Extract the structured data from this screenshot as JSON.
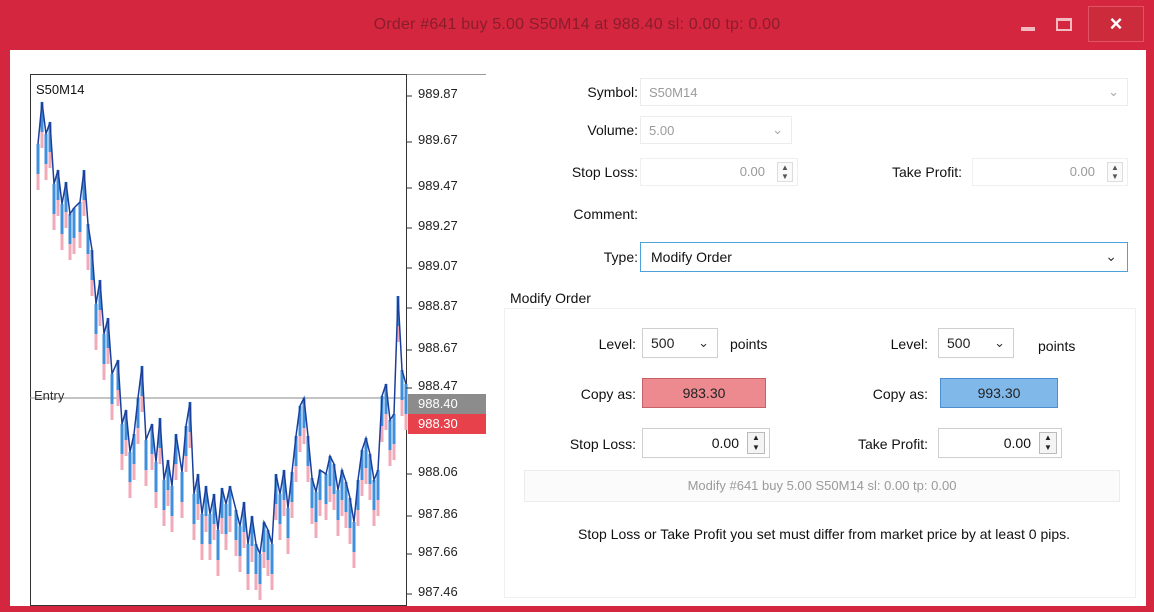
{
  "window": {
    "title": "Order #641 buy 5.00 S50M14 at 988.40 sl: 0.00 tp: 0.00",
    "close_label": "×"
  },
  "chart": {
    "symbol": "S50M14",
    "entry_label": "Entry",
    "price_labels": [
      "989.87",
      "989.67",
      "989.47",
      "989.27",
      "989.07",
      "988.87",
      "988.67",
      "988.47",
      "988.06",
      "987.86",
      "987.66",
      "987.46"
    ],
    "price_tags": {
      "ask": "988.40",
      "bid": "988.30"
    },
    "colors": {
      "line": "#1c3f9a",
      "band_blue": "#3f8fdc",
      "band_pink": "#f1aab8",
      "tag_gray": "#8c8c8c",
      "tag_red": "#e7414b"
    }
  },
  "form": {
    "symbol_label": "Symbol:",
    "symbol_value": "S50M14",
    "volume_label": "Volume:",
    "volume_value": "5.00",
    "stop_loss_label": "Stop Loss:",
    "stop_loss_value": "0.00",
    "take_profit_label": "Take Profit:",
    "take_profit_value": "0.00",
    "comment_label": "Comment:",
    "type_label": "Type:",
    "type_value": "Modify Order"
  },
  "modify": {
    "group_title": "Modify Order",
    "sl": {
      "level_label": "Level:",
      "level_value": "500",
      "points_label": "points",
      "copy_label": "Copy as:",
      "copy_value": "983.30",
      "stop_label": "Stop Loss:",
      "stop_value": "0.00"
    },
    "tp": {
      "level_label": "Level:",
      "level_value": "500",
      "points_label": "points",
      "copy_label": "Copy as:",
      "copy_value": "993.30",
      "take_label": "Take Profit:",
      "take_value": "0.00"
    },
    "modify_button": "Modify #641 buy 5.00 S50M14 sl: 0.00 tp: 0.00",
    "warning": "Stop Loss or Take Profit you set must differ from market price by at least 0 pips."
  }
}
